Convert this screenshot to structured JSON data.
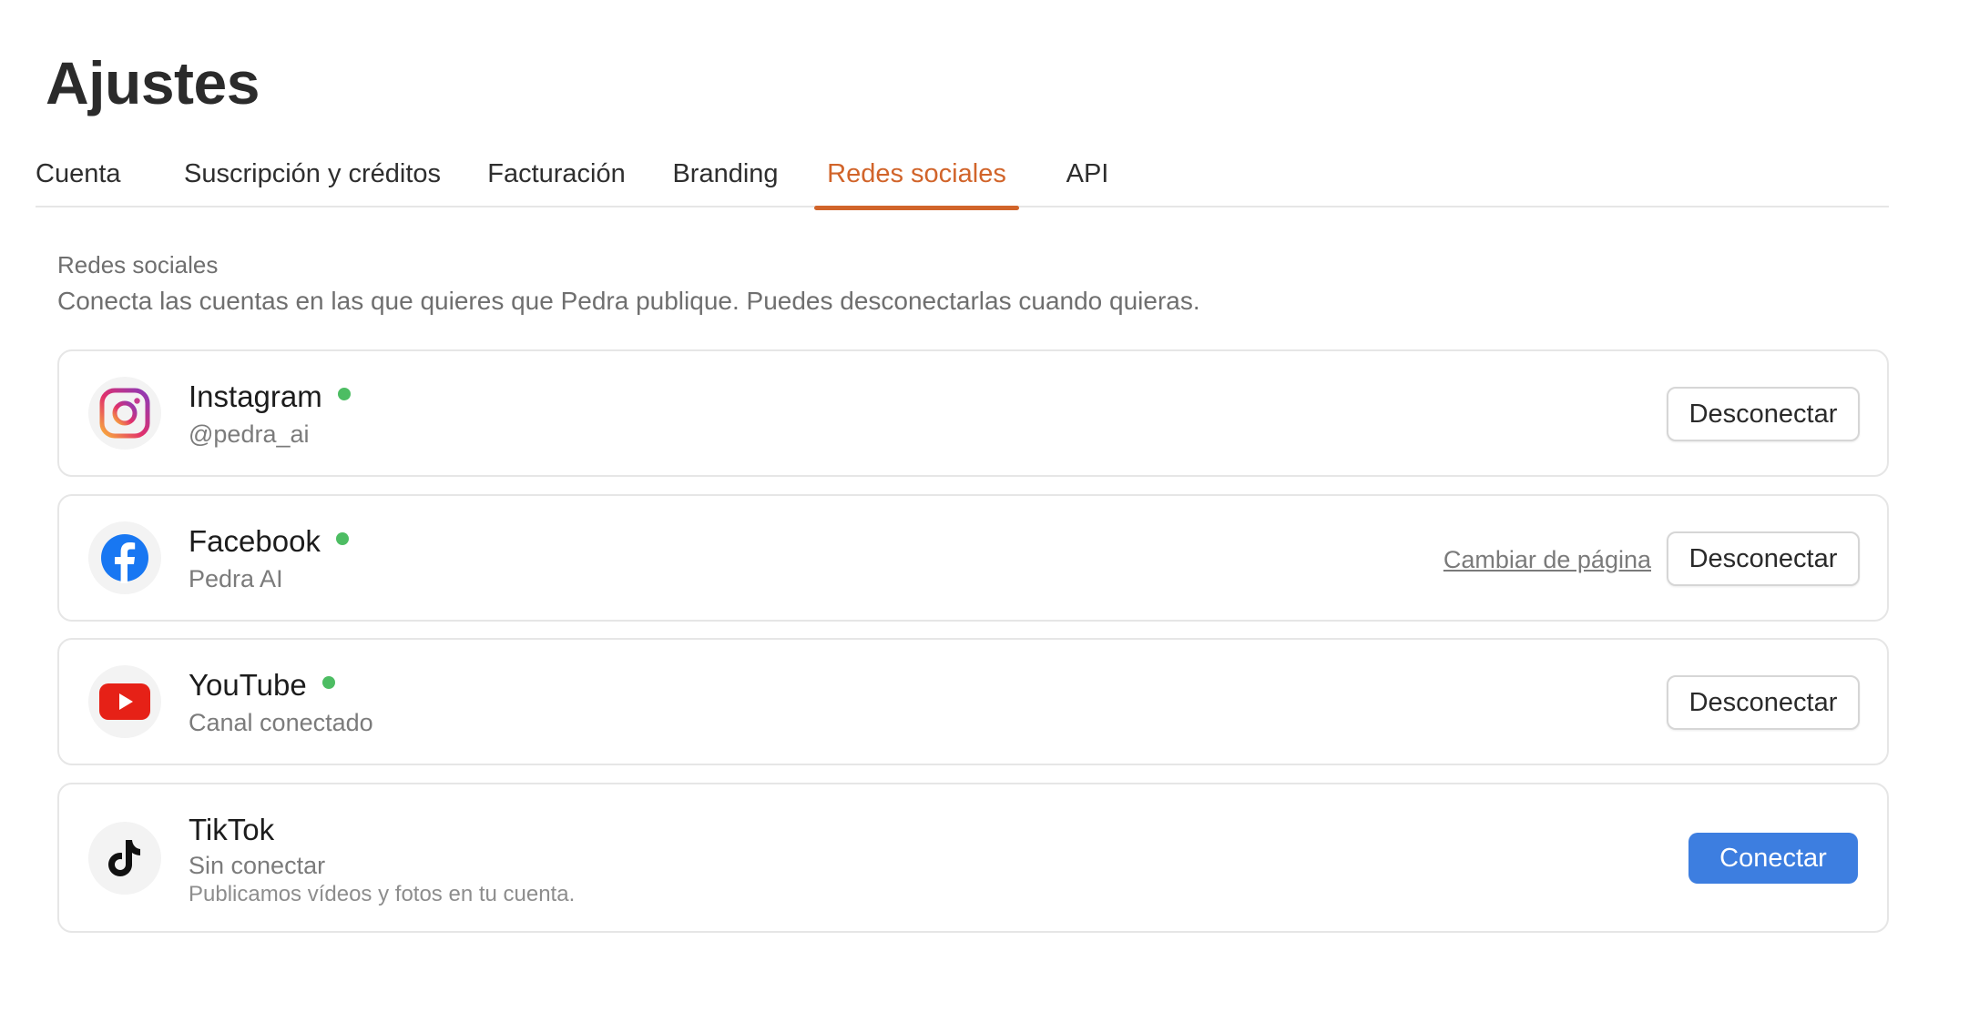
{
  "header": {
    "title": "Ajustes"
  },
  "tabs": [
    {
      "label": "Cuenta",
      "active": false
    },
    {
      "label": "Suscripción y créditos",
      "active": false
    },
    {
      "label": "Facturación",
      "active": false
    },
    {
      "label": "Branding",
      "active": false
    },
    {
      "label": "Redes sociales",
      "active": true
    },
    {
      "label": "API",
      "active": false
    }
  ],
  "section": {
    "heading": "Redes sociales",
    "description": "Conecta las cuentas en las que quieres que Pedra publique. Puedes desconectarlas cuando quieras."
  },
  "accounts": [
    {
      "name": "Instagram",
      "icon": "instagram-icon",
      "connected": true,
      "subtitle": "@pedra_ai",
      "action_label": "Desconectar"
    },
    {
      "name": "Facebook",
      "icon": "facebook-icon",
      "connected": true,
      "subtitle": "Pedra AI",
      "link_label": "Cambiar de página",
      "action_label": "Desconectar"
    },
    {
      "name": "YouTube",
      "icon": "youtube-icon",
      "connected": true,
      "subtitle": "Canal conectado",
      "action_label": "Desconectar"
    },
    {
      "name": "TikTok",
      "icon": "tiktok-icon",
      "connected": false,
      "subtitle": "Sin conectar",
      "note": "Publicamos vídeos y fotos en tu cuenta.",
      "action_label": "Conectar"
    }
  ],
  "colors": {
    "accent": "#d1642a",
    "connected_dot": "#4dbd63",
    "primary_button": "#3d7ee0",
    "facebook_blue": "#1877f2",
    "youtube_red": "#e62117"
  }
}
